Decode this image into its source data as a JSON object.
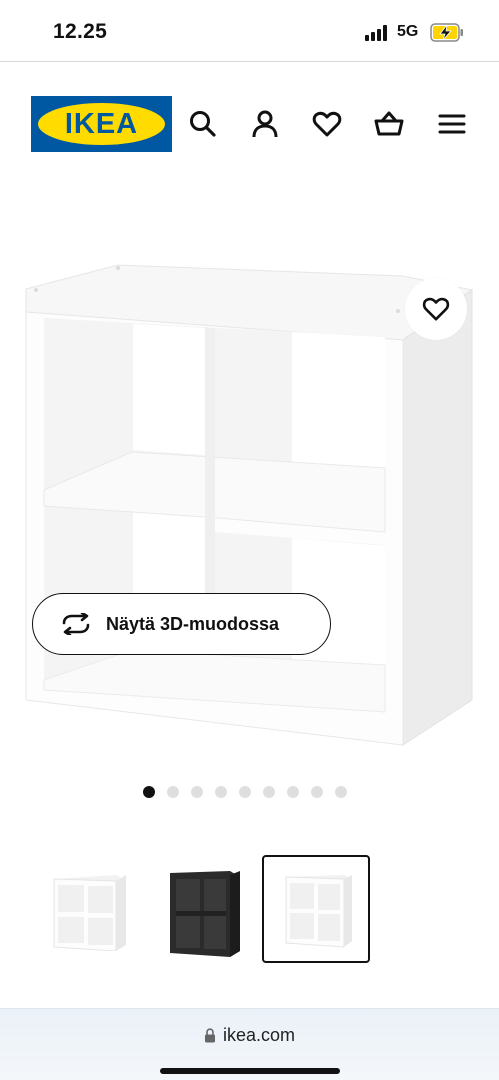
{
  "status_bar": {
    "time": "12.25",
    "network": "5G",
    "signal_bars": 4,
    "battery_charging": true
  },
  "header": {
    "logo_text": "IKEA",
    "icons": [
      "search-icon",
      "user-icon",
      "heart-icon",
      "cart-icon",
      "menu-icon"
    ]
  },
  "product": {
    "view_3d_label": "Näytä 3D-muodossa",
    "carousel": {
      "total": 9,
      "active": 1
    },
    "thumbnails": [
      {
        "variant": "white",
        "selected": false
      },
      {
        "variant": "black-brown",
        "selected": false
      },
      {
        "variant": "white",
        "selected": true
      }
    ]
  },
  "browser": {
    "url": "ikea.com"
  },
  "colors": {
    "brand_blue": "#0058a3",
    "brand_yellow": "#ffdb00",
    "text": "#111111",
    "dot_inactive": "#dfdfdf"
  }
}
